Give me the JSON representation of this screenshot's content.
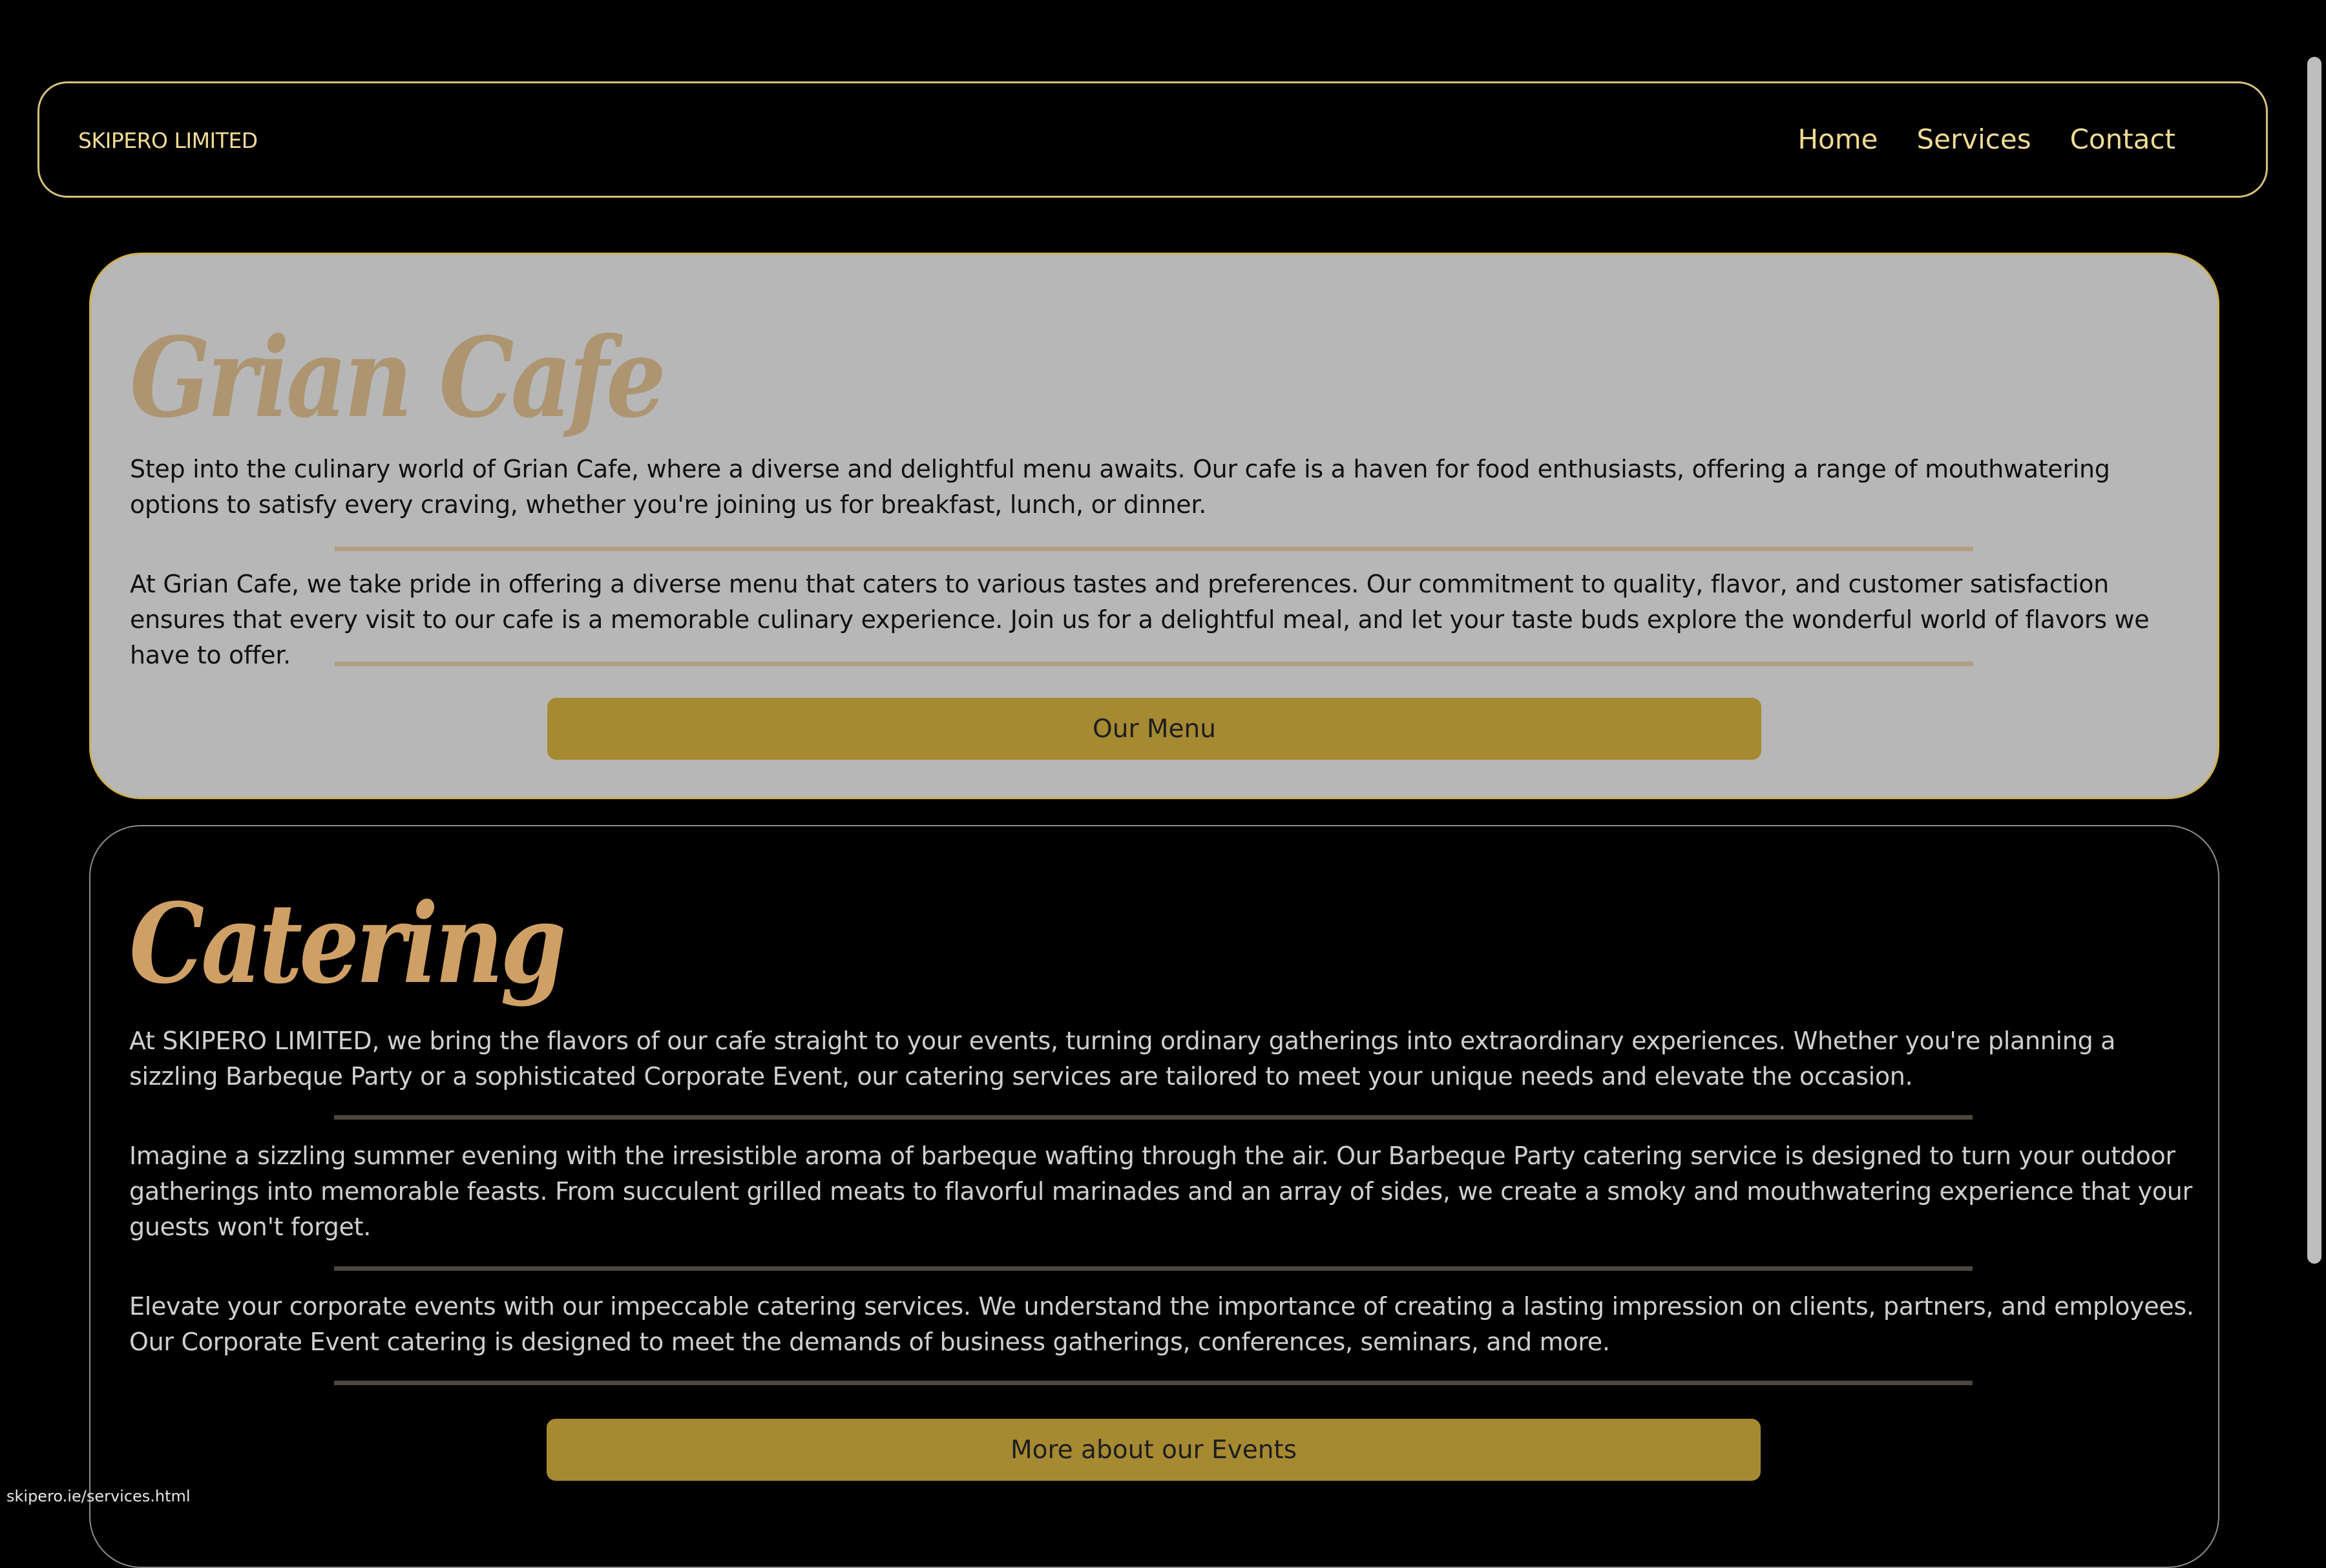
{
  "navbar": {
    "brand": "SKIPERO LIMITED",
    "links": [
      "Home",
      "Services",
      "Contact"
    ]
  },
  "cafe": {
    "title": "Grian Cafe",
    "paragraphs": [
      "Step into the culinary world of Grian Cafe, where a diverse and delightful menu awaits. Our cafe is a haven for food enthusiasts, offering a range of mouthwatering options to satisfy every craving, whether you're joining us for breakfast, lunch, or dinner.",
      "At Grian Cafe, we take pride in offering a diverse menu that caters to various tastes and preferences. Our commitment to quality, flavor, and customer satisfaction ensures that every visit to our cafe is a memorable culinary experience. Join us for a delightful meal, and let your taste buds explore the wonderful world of flavors we have to offer."
    ],
    "button_label": "Our Menu"
  },
  "catering": {
    "title": "Catering",
    "paragraphs": [
      "At SKIPERO LIMITED, we bring the flavors of our cafe straight to your events, turning ordinary gatherings into extraordinary experiences. Whether you're planning a sizzling Barbeque Party or a sophisticated Corporate Event, our catering services are tailored to meet your unique needs and elevate the occasion.",
      "Imagine a sizzling summer evening with the irresistible aroma of barbeque wafting through the air. Our Barbeque Party catering service is designed to turn your outdoor gatherings into memorable feasts. From succulent grilled meats to flavorful marinades and an array of sides, we create a smoky and mouthwatering experience that your guests won't forget.",
      "Elevate your corporate events with our impeccable catering services. We understand the importance of creating a lasting impression on clients, partners, and employees. Our Corporate Event catering is designed to meet the demands of business gatherings, conferences, seminars, and more."
    ],
    "button_label": "More about our Events"
  },
  "status_bar": {
    "url": "skipero.ie/services.html"
  },
  "colors": {
    "background": "#000000",
    "accent": "#f0dc95",
    "button": "#a68a32",
    "cafe_card": "#b7b7b7",
    "cafe_title": "#ad9572",
    "catering_title": "#cfa066"
  }
}
